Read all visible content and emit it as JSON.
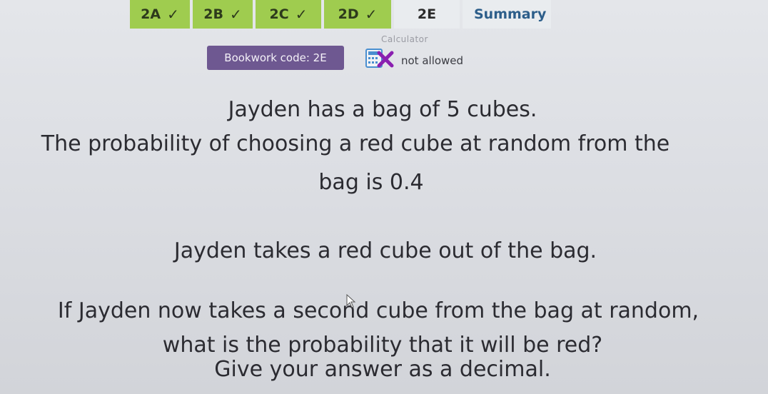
{
  "tabs": [
    {
      "label": "2A",
      "completed": true
    },
    {
      "label": "2B",
      "completed": true
    },
    {
      "label": "2C",
      "completed": true
    },
    {
      "label": "2D",
      "completed": true
    },
    {
      "label": "2E",
      "completed": false,
      "current": true
    },
    {
      "label": "Summary"
    }
  ],
  "check_glyph": "✓",
  "bookwork": {
    "label": "Bookwork code: 2E"
  },
  "calculator": {
    "label": "Calculator",
    "status": "not allowed",
    "icon": "calculator-crossed-icon"
  },
  "question": {
    "lines": [
      "Jayden has a bag of 5 cubes.",
      "The probability of choosing a red cube at random from the",
      "bag is 0.4",
      "Jayden takes a red cube out of the bag.",
      "If Jayden now takes a second cube from the bag at random,",
      "what is the probability that it will be red?",
      "Give your answer as a decimal."
    ]
  },
  "colors": {
    "tab_completed": "#9fcc4f",
    "tab_current": "#e9ecef",
    "bookwork_bg": "#6e5891",
    "summary_text": "#2d5e8a",
    "cross": "#8a1fb0"
  }
}
